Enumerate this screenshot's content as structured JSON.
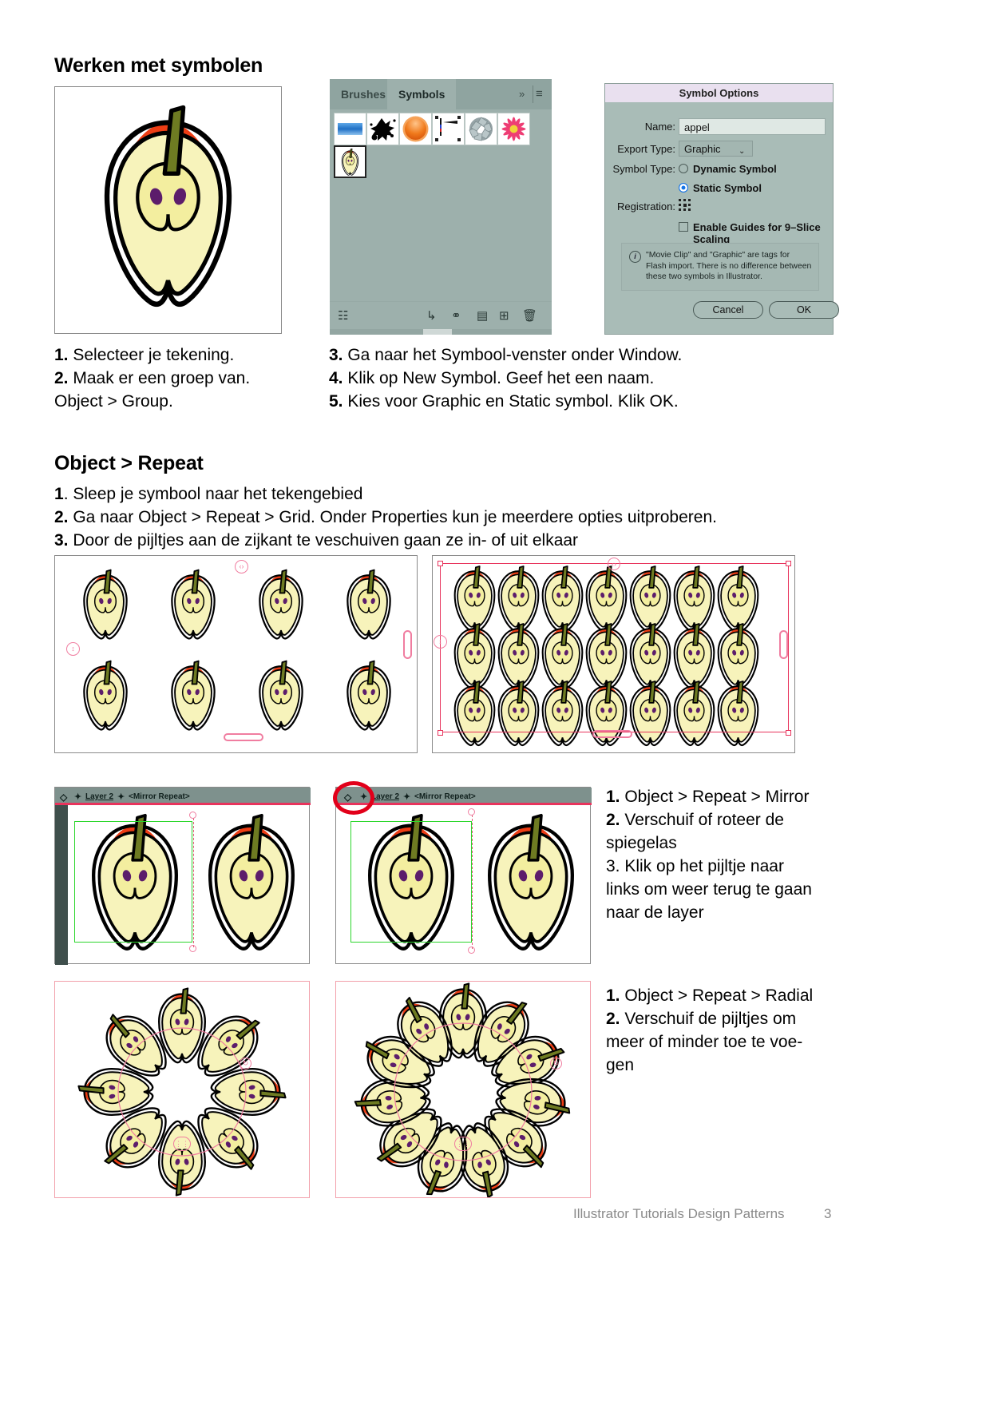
{
  "document": {
    "section1_title": "Werken met symbolen",
    "section2_title": "Object > Repeat"
  },
  "symbols_panel": {
    "tab_brushes": "Brushes",
    "tab_symbols": "Symbols",
    "menu_chevrons": "»",
    "menu_hamburger": "≡",
    "symbol_cells": [
      {
        "name": "blue-gradient-symbol"
      },
      {
        "name": "ink-splat-symbol"
      },
      {
        "name": "orange-button-symbol"
      },
      {
        "name": "gradient-slider-symbol"
      },
      {
        "name": "grey-ribbon-ring-symbol"
      },
      {
        "name": "pink-daisy-symbol"
      },
      {
        "name": "apple-symbol"
      }
    ],
    "footer_icons": [
      "symbol-libraries-icon",
      "place-symbol-instance-icon",
      "break-link-icon",
      "symbol-options-icon",
      "new-symbol-icon",
      "delete-symbol-icon"
    ]
  },
  "symbol_options": {
    "title": "Symbol Options",
    "name_label": "Name:",
    "name_value": "appel",
    "export_label": "Export Type:",
    "export_value": "Graphic",
    "symbol_type_label": "Symbol Type:",
    "dynamic_label": "Dynamic Symbol",
    "static_label": "Static Symbol",
    "registration_label": "Registration:",
    "guides_label": "Enable Guides for 9–Slice Scaling",
    "note": "\"Movie Clip\" and \"Graphic\" are tags for Flash import. There is no difference between these two symbols in Illustrator.",
    "cancel": "Cancel",
    "ok": "OK",
    "accent": "#1473e6",
    "titlebar_color": "#e9e0ef",
    "dialog_color": "#a9bcb7"
  },
  "steps_left": [
    {
      "num": "1.",
      "text": " Selecteer je tekening."
    },
    {
      "num": "2.",
      "text": " Maak er een groep van."
    },
    {
      "num": "",
      "text": "Object > Group."
    }
  ],
  "steps_right": [
    {
      "num": "3.",
      "text": " Ga naar het Symbool-venster onder Window."
    },
    {
      "num": "4.",
      "text": " Klik op New Symbol. Geef het een naam."
    },
    {
      "num": "5.",
      "text": " Kies voor Graphic en Static symbol. Klik OK."
    }
  ],
  "repeat_steps": [
    {
      "num": "1",
      "text": ". Sleep je symbool naar het tekengebied"
    },
    {
      "num": "2.",
      "text": " Ga naar Object > Repeat > Grid. Onder Properties kun je meerdere opties uitproberen."
    },
    {
      "num": "3.",
      "text": " Door de pijltjes aan de zijkant te veschuiven gaan ze in- of uit elkaar"
    }
  ],
  "layer_bars": {
    "back_arrow_icon": "◁",
    "layer_name": "Layer 2",
    "repeat_name": "<Mirror Repeat>"
  },
  "mirror_text": [
    {
      "num": "1.",
      "text": " Object > Repeat > Mirror"
    },
    {
      "num": "2.",
      "text": " Verschuif of roteer de"
    },
    {
      "num": "",
      "text": "spiegelas"
    },
    {
      "num": "",
      "text": "3. Klik op het pijltje naar"
    },
    {
      "num": "",
      "text": "links om weer terug te gaan"
    },
    {
      "num": "",
      "text": "naar de layer"
    }
  ],
  "radial_text": [
    {
      "num": "1.",
      "text": " Object > Repeat > Radial"
    },
    {
      "num": "2.",
      "text": " Verschuif de pijltjes om"
    },
    {
      "num": "",
      "text": "meer of minder toe te voe-"
    },
    {
      "num": "",
      "text": "gen"
    }
  ],
  "footer": {
    "title": "Illustrator Tutorials Design Patterns",
    "page": "3"
  },
  "apple_colors": {
    "flesh": "#f7f3bb",
    "core": "#f3ee9f",
    "skin_red": "#ee3d14",
    "stem": "#6e7b22",
    "seed": "#5c1d6b",
    "outline": "#000000"
  }
}
